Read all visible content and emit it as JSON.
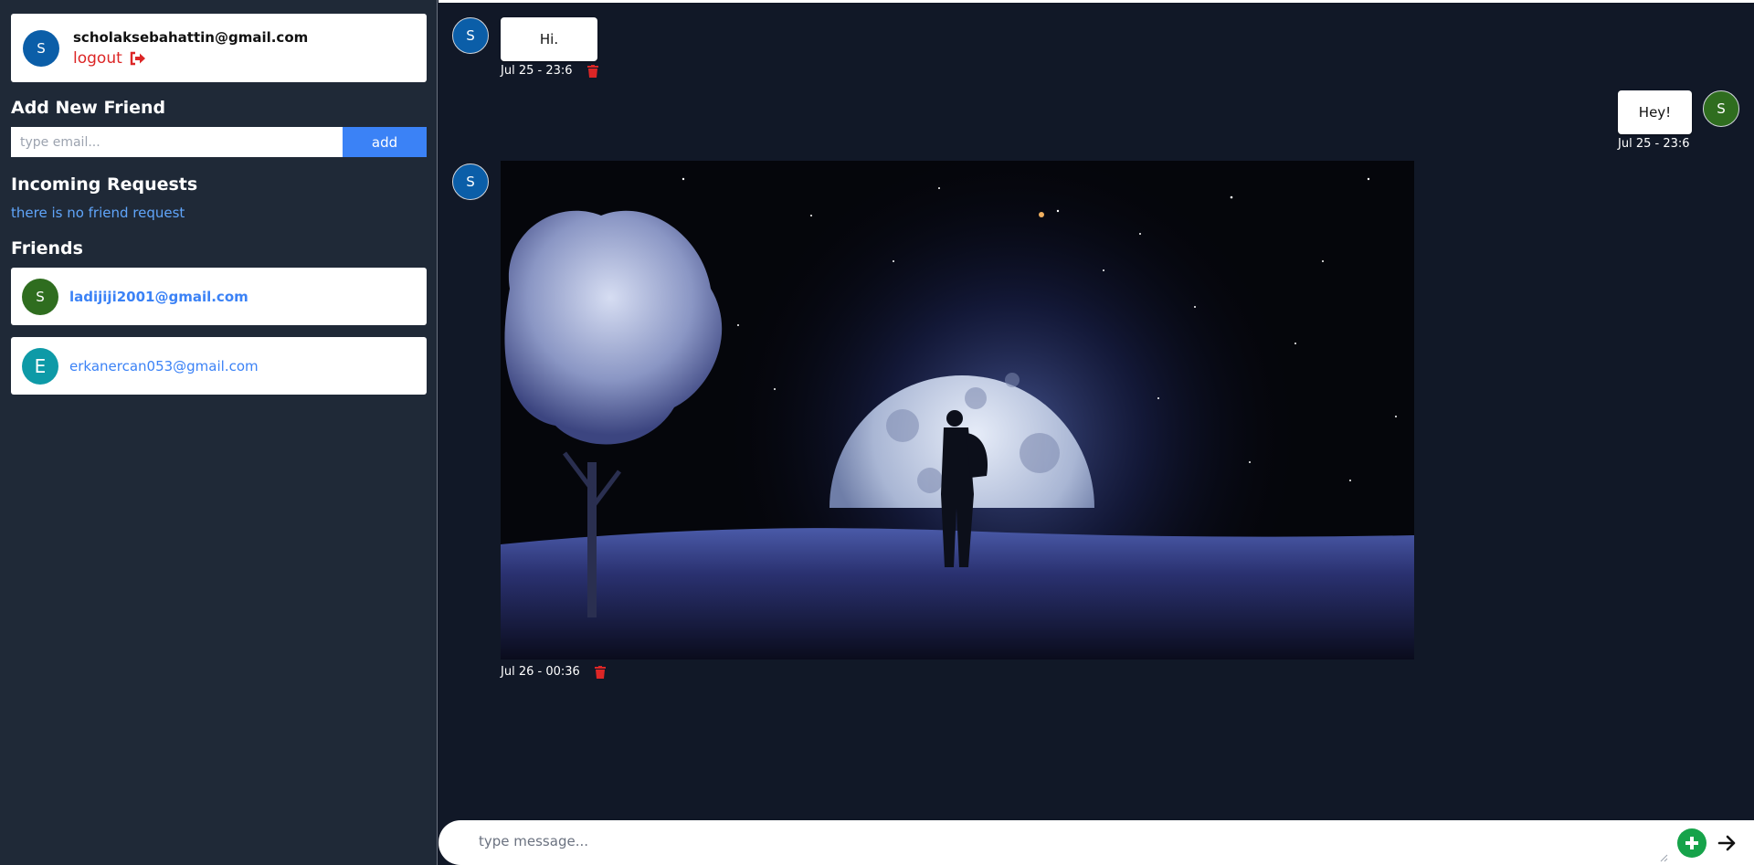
{
  "current_user": {
    "avatar_letter": "S",
    "avatar_color": "#0b5ea8",
    "email": "scholaksebahattin@gmail.com",
    "logout_label": "logout",
    "logout_icon": "sign-out-icon"
  },
  "add_friend": {
    "title": "Add New Friend",
    "input_placeholder": "type email...",
    "input_value": "",
    "button_label": "add"
  },
  "incoming_requests": {
    "title": "Incoming Requests",
    "empty_text": "there is no friend request"
  },
  "friends": {
    "title": "Friends",
    "items": [
      {
        "avatar_letter": "S",
        "avatar_color": "#2f6d1f",
        "email": "ladijiji2001@gmail.com",
        "active": true
      },
      {
        "avatar_letter": "E",
        "avatar_color": "#0e9aa7",
        "email": "erkanercan053@gmail.com",
        "active": false
      }
    ]
  },
  "messages": [
    {
      "side": "left",
      "type": "text",
      "avatar_letter": "S",
      "avatar_color": "#0b5ea8",
      "text": "Hi.",
      "timestamp": "Jul 25 - 23:6",
      "deletable": true
    },
    {
      "side": "right",
      "type": "text",
      "avatar_letter": "S",
      "avatar_color": "#2f6d1f",
      "text": "Hey!",
      "timestamp": "Jul 25 - 23:6",
      "deletable": false
    },
    {
      "side": "left",
      "type": "image",
      "avatar_letter": "S",
      "avatar_color": "#0b5ea8",
      "image_subject": "night-moon-silhouette",
      "timestamp": "Jul 26 - 00:36",
      "deletable": true
    }
  ],
  "composer": {
    "placeholder": "type message...",
    "value": "",
    "attach_icon": "plus-circle-icon",
    "attach_color": "#16a34a",
    "send_icon": "arrow-right-icon"
  },
  "colors": {
    "sidebar_bg": "#1f2937",
    "chat_bg": "#111827",
    "accent": "#3b82f6",
    "danger": "#dc2626"
  }
}
